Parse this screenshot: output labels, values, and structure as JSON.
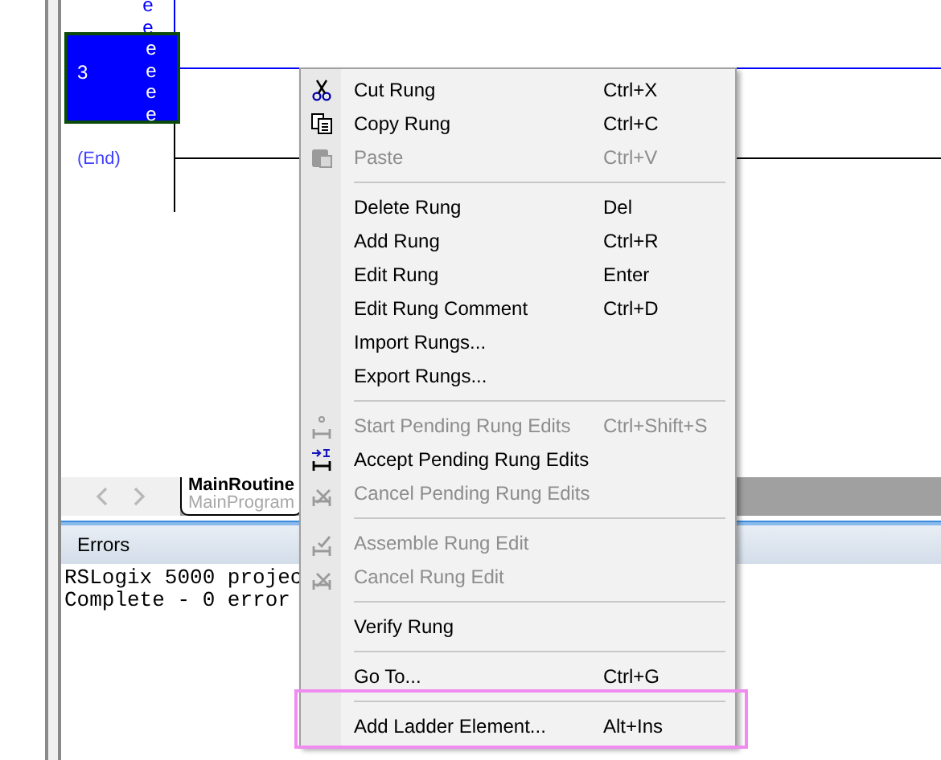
{
  "ladder": {
    "previous_rung_marks": [
      "e",
      "e"
    ],
    "rungs": [
      {
        "number": "3",
        "selected": true,
        "marks": [
          "e",
          "e",
          "e",
          "e"
        ]
      }
    ],
    "end_label": "(End)"
  },
  "routine_tabs": [
    {
      "title": "MainRoutine",
      "subtitle": "MainProgram",
      "selected": true
    }
  ],
  "errors_panel": {
    "title": "Errors",
    "lines": [
      "RSLogix 5000 projec",
      "Complete - 0 error"
    ]
  },
  "context_menu": {
    "items": [
      {
        "kind": "item",
        "label": "Cut Rung",
        "shortcut": "Ctrl+X",
        "disabled": false
      },
      {
        "kind": "item",
        "label": "Copy Rung",
        "shortcut": "Ctrl+C",
        "disabled": false
      },
      {
        "kind": "item",
        "label": "Paste",
        "shortcut": "Ctrl+V",
        "disabled": true
      },
      {
        "kind": "separator"
      },
      {
        "kind": "item",
        "label": "Delete Rung",
        "shortcut": "Del",
        "disabled": false
      },
      {
        "kind": "item",
        "label": "Add Rung",
        "shortcut": "Ctrl+R",
        "disabled": false
      },
      {
        "kind": "item",
        "label": "Edit Rung",
        "shortcut": "Enter",
        "disabled": false
      },
      {
        "kind": "item",
        "label": "Edit Rung Comment",
        "shortcut": "Ctrl+D",
        "disabled": false
      },
      {
        "kind": "item",
        "label": "Import Rungs...",
        "disabled": false
      },
      {
        "kind": "item",
        "label": "Export Rungs...",
        "disabled": false
      },
      {
        "kind": "separator"
      },
      {
        "kind": "item",
        "label": "Start Pending Rung Edits",
        "shortcut": "Ctrl+Shift+S",
        "disabled": true
      },
      {
        "kind": "item",
        "label": "Accept Pending Rung Edits",
        "disabled": false
      },
      {
        "kind": "item",
        "label": "Cancel Pending Rung Edits",
        "disabled": true
      },
      {
        "kind": "separator"
      },
      {
        "kind": "item",
        "label": "Assemble Rung Edit",
        "disabled": true
      },
      {
        "kind": "item",
        "label": "Cancel Rung Edit",
        "disabled": true
      },
      {
        "kind": "separator"
      },
      {
        "kind": "item",
        "label": "Verify Rung",
        "disabled": false
      },
      {
        "kind": "separator"
      },
      {
        "kind": "item",
        "label": "Go To...",
        "shortcut": "Ctrl+G",
        "disabled": false
      },
      {
        "kind": "separator"
      },
      {
        "kind": "item",
        "label": "Add Ladder Element...",
        "shortcut": "Alt+Ins",
        "disabled": false,
        "highlighted": true
      }
    ]
  }
}
